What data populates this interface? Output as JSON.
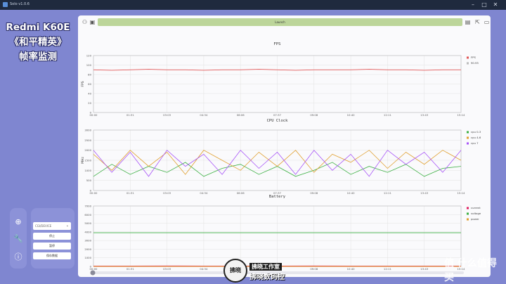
{
  "window": {
    "title": "Solo v1.0.6",
    "min": "–",
    "max": "□",
    "close": "✕"
  },
  "promo": {
    "line1": "Redmi K60E",
    "line2": "《和平精英》",
    "line3": "帧率监测"
  },
  "sidebar": {
    "icons": [
      "add-circle-icon",
      "wrench-icon",
      "info-icon"
    ],
    "device_select": "CGI/DEVICE",
    "buttons": [
      "停止",
      "暂停",
      "保存数据"
    ]
  },
  "toolbar": {
    "address": "Launch",
    "left_icons": [
      "user-icon",
      "image-icon"
    ],
    "right_icons": [
      "copy-icon",
      "export-icon",
      "folder-icon"
    ]
  },
  "time_ticks": [
    "00:00",
    "01:31",
    "03:03",
    "04:34",
    "06:06",
    "07:37",
    "09:08",
    "10:40",
    "12:11",
    "13:43",
    "15:14"
  ],
  "charts": [
    {
      "title": "FPS",
      "ylabel": "FPS",
      "yticks": [
        "0",
        "20",
        "40",
        "60",
        "80",
        "100",
        "120"
      ],
      "legend": [
        {
          "name": "FPS",
          "color": "#e05555"
        },
        {
          "name": "90.95",
          "color": "#bbbbbb"
        }
      ]
    },
    {
      "title": "CPU Clock",
      "ylabel": "MHz",
      "yticks": [
        "0",
        "500",
        "1000",
        "1500",
        "2000",
        "2500",
        "3000"
      ],
      "legend": [
        {
          "name": "cpu 0-3",
          "color": "#3cb043"
        },
        {
          "name": "cpu 4-6",
          "color": "#e0a030"
        },
        {
          "name": "cpu 7",
          "color": "#a855f7"
        }
      ]
    },
    {
      "title": "Battery",
      "ylabel": "",
      "yticks": [
        "0",
        "1000",
        "2000",
        "3000",
        "4000",
        "5000",
        "6000",
        "7000"
      ],
      "legend": [
        {
          "name": "current",
          "color": "#e02060"
        },
        {
          "name": "voltage",
          "color": "#3cb043"
        },
        {
          "name": "power",
          "color": "#e0a030"
        }
      ]
    }
  ],
  "chart_data": [
    {
      "type": "line",
      "title": "FPS",
      "ylabel": "FPS",
      "ylim": [
        0,
        120
      ],
      "xlim": [
        "00:00",
        "15:14"
      ],
      "series": [
        {
          "name": "FPS",
          "values": [
            90,
            89,
            90,
            91,
            90,
            90,
            89,
            90,
            90,
            91,
            90,
            89,
            90,
            90,
            90,
            91,
            90,
            90,
            89,
            90,
            90
          ]
        }
      ]
    },
    {
      "type": "line",
      "title": "CPU Clock",
      "ylabel": "MHz",
      "ylim": [
        0,
        3000
      ],
      "xlim": [
        "00:00",
        "15:14"
      ],
      "series": [
        {
          "name": "cpu 0-3",
          "values": [
            700,
            1300,
            800,
            1200,
            900,
            1400,
            700,
            1100,
            1300,
            800,
            1200,
            700,
            1000,
            1400,
            800,
            1200,
            900,
            1300,
            700,
            1100,
            1200
          ]
        },
        {
          "name": "cpu 4-6",
          "values": [
            1800,
            1000,
            2000,
            1200,
            1900,
            800,
            2000,
            1500,
            1000,
            1900,
            1200,
            2000,
            900,
            1800,
            1400,
            2000,
            1100,
            1900,
            1300,
            2000,
            1500
          ]
        },
        {
          "name": "cpu 7",
          "values": [
            2000,
            900,
            1900,
            700,
            2000,
            1200,
            1800,
            800,
            2000,
            1100,
            1900,
            800,
            2000,
            1000,
            1800,
            700,
            2000,
            1300,
            1900,
            900,
            2000
          ]
        }
      ]
    },
    {
      "type": "line",
      "title": "Battery",
      "ylim": [
        0,
        7000
      ],
      "xlim": [
        "00:00",
        "15:14"
      ],
      "series": [
        {
          "name": "current",
          "values": [
            50,
            40,
            60,
            50,
            40,
            50,
            60,
            50,
            40,
            50,
            50
          ]
        },
        {
          "name": "voltage",
          "values": [
            3900,
            3900,
            3900,
            3900,
            3900,
            3900,
            3900,
            3900,
            3900,
            3900,
            3900
          ]
        },
        {
          "name": "power",
          "values": [
            0,
            0,
            0,
            0,
            0,
            0,
            0,
            0,
            0,
            0,
            0
          ]
        }
      ]
    }
  ],
  "watermarks": {
    "badge": "拂晓",
    "studio": "拂晓工作室",
    "brand": "拂晓数码控",
    "site": "值 什么值得买"
  }
}
